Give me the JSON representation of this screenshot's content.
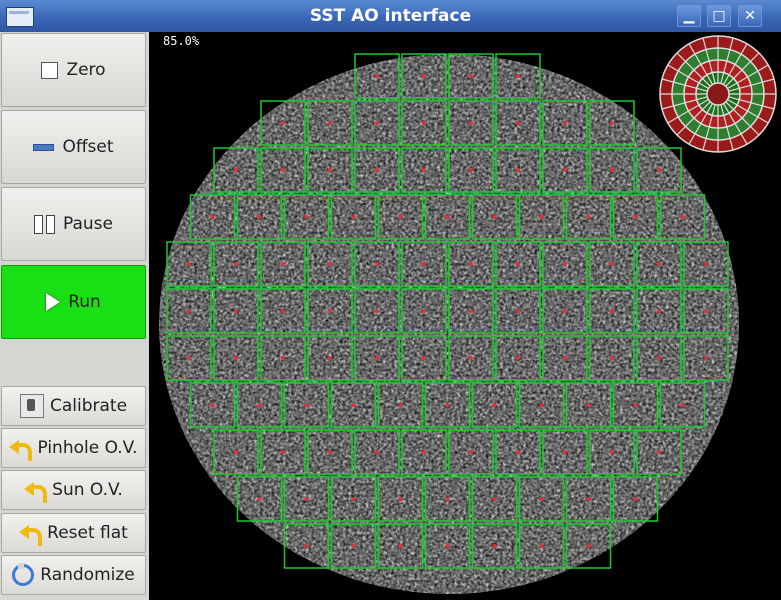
{
  "window": {
    "title": "SST AO interface",
    "min_label": "▁",
    "max_label": "□",
    "close_label": "✕"
  },
  "controls": {
    "zero": "Zero",
    "offset": "Offset",
    "pause": "Pause",
    "run": "Run",
    "calibrate": "Calibrate",
    "pinhole": "Pinhole O.V.",
    "sun": "Sun O.V.",
    "reset": "Reset flat",
    "randomize": "Randomize"
  },
  "viewer": {
    "percent": "85.0%"
  },
  "colors": {
    "run_active": "#19e014",
    "subaperture_box": "#1ec832",
    "spot": "#e0303a",
    "title_bar": "#3765b4"
  }
}
